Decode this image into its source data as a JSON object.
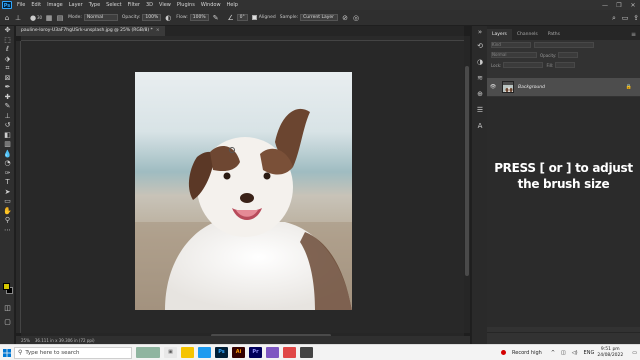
{
  "menubar": {
    "app_logo": "Ps",
    "items": [
      "File",
      "Edit",
      "Image",
      "Layer",
      "Type",
      "Select",
      "Filter",
      "3D",
      "View",
      "Plugins",
      "Window",
      "Help"
    ],
    "controls": [
      "—",
      "❐",
      "✕"
    ]
  },
  "options": {
    "brush_size": "30",
    "mode_label": "Mode:",
    "mode_value": "Normal",
    "opacity_label": "Opacity:",
    "opacity_value": "100%",
    "flow_label": "Flow:",
    "flow_value": "100%",
    "angle_value": "0°",
    "aligned_label": "Aligned",
    "sample_label": "Sample:",
    "sample_value": "Current Layer"
  },
  "document": {
    "tab_title": "pauline-loroy-U3aF7hgUSrk-unsplash.jpg @ 25% (RGB/8) *",
    "tab_close": "×"
  },
  "status": {
    "zoom": "25%",
    "doc_size": "36.111 in x 39.306 in (72 ppi)"
  },
  "layers": {
    "tabs": [
      "Layers",
      "Channels",
      "Paths"
    ],
    "kind_placeholder": "Kind",
    "blend_mode": "Normal",
    "opacity_label": "Opacity:",
    "fill_label": "Fill:",
    "lock_label": "Lock:",
    "layer_name": "Background"
  },
  "overlay": {
    "line1": "PRESS [ or ] to adjust",
    "line2": "the brush size"
  },
  "taskbar": {
    "search_placeholder": "Type here to search",
    "recording": "Record high",
    "language": "ENG",
    "time": "9:51 pm",
    "date": "24/08/2022",
    "apps": [
      "Ps",
      "Ai",
      "Pr"
    ]
  },
  "colors": {
    "foreground": "#d4c600",
    "background": "#000000",
    "accent": "#31a8ff"
  }
}
